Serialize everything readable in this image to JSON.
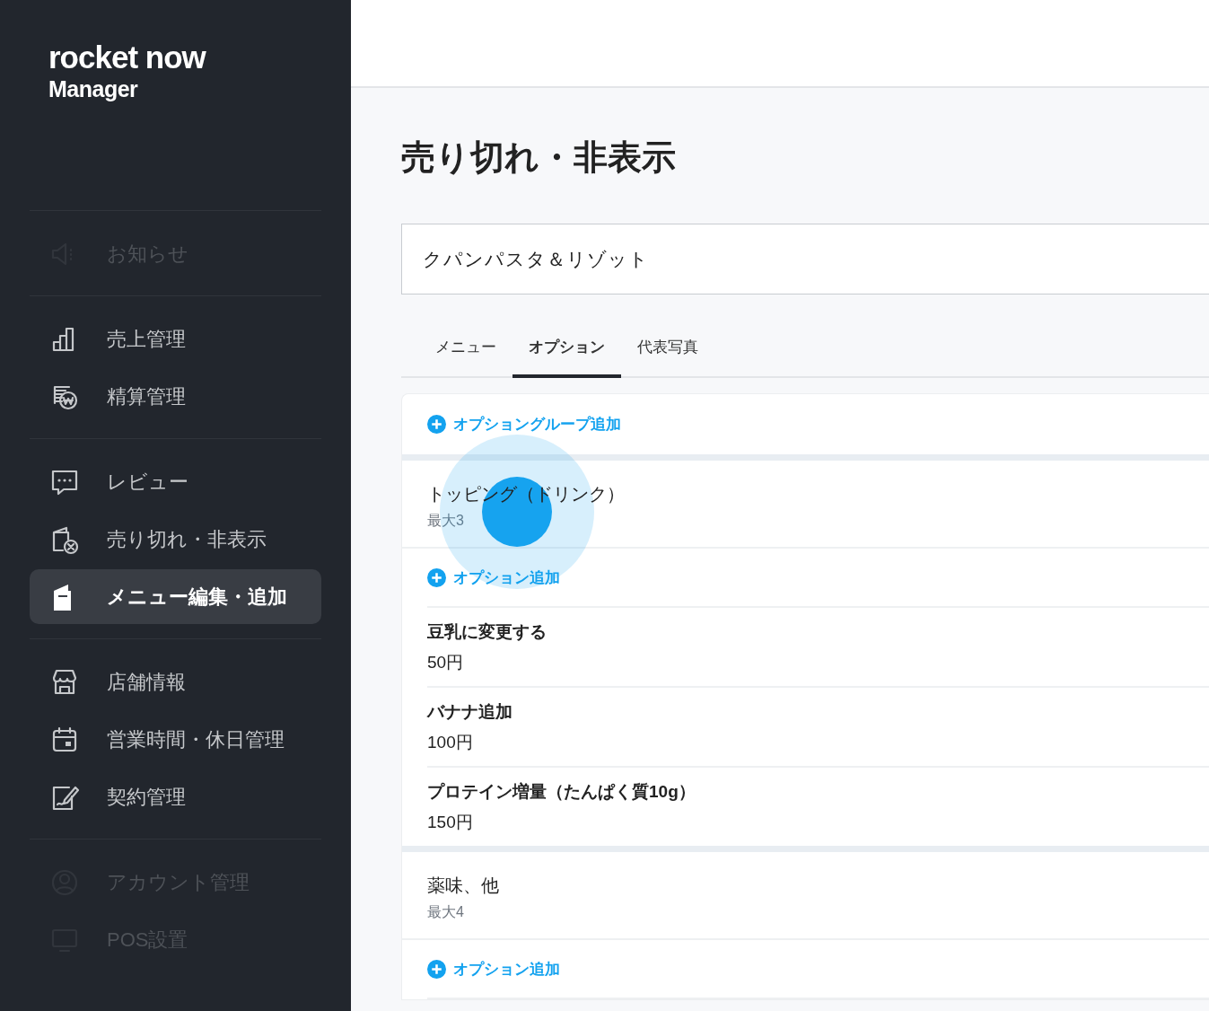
{
  "sidebar": {
    "logo": "rocket now",
    "subtitle": "Manager",
    "groups": [
      {
        "items": [
          {
            "kind": "megaphone",
            "label": "お知らせ",
            "selected": false,
            "dimmed": true
          }
        ]
      },
      {
        "items": [
          {
            "kind": "chart",
            "label": "売上管理",
            "selected": false,
            "dimmed": false
          },
          {
            "kind": "coins",
            "label": "精算管理",
            "selected": false,
            "dimmed": false
          }
        ]
      },
      {
        "items": [
          {
            "kind": "chat",
            "label": "レビュー",
            "selected": false,
            "dimmed": false
          },
          {
            "kind": "soldout",
            "label": "売り切れ・非表示",
            "selected": false,
            "dimmed": false
          },
          {
            "kind": "menu",
            "label": "メニュー編集・追加",
            "selected": true,
            "dimmed": false
          }
        ]
      },
      {
        "items": [
          {
            "kind": "store",
            "label": "店舗情報",
            "selected": false,
            "dimmed": false
          },
          {
            "kind": "calendar",
            "label": "営業時間・休日管理",
            "selected": false,
            "dimmed": false
          },
          {
            "kind": "contract",
            "label": "契約管理",
            "selected": false,
            "dimmed": false
          }
        ]
      },
      {
        "items": [
          {
            "kind": "account",
            "label": "アカウント管理",
            "selected": false,
            "dimmed": true
          },
          {
            "kind": "monitor",
            "label": "POS設置",
            "selected": false,
            "dimmed": true
          }
        ]
      }
    ]
  },
  "page": {
    "title": "売り切れ・非表示",
    "store": "クパンパスタ＆リゾット",
    "tabs": [
      {
        "label": "メニュー",
        "selected": false
      },
      {
        "label": "オプション",
        "selected": true
      },
      {
        "label": "代表写真",
        "selected": false
      }
    ],
    "add_group": "オプショングループ追加",
    "groups": [
      {
        "name": "トッピング（ドリンク）",
        "max": "最大3",
        "add_option": "オプション追加",
        "options": [
          {
            "name": "豆乳に変更する",
            "price": "50円"
          },
          {
            "name": "バナナ追加",
            "price": "100円"
          },
          {
            "name": "プロテイン増量（たんぱく質10g）",
            "price": "150円"
          }
        ]
      },
      {
        "name": "薬味、他",
        "max": "最大4",
        "add_option": "オプション追加"
      }
    ]
  },
  "touch_indicator": {
    "visible": true
  }
}
